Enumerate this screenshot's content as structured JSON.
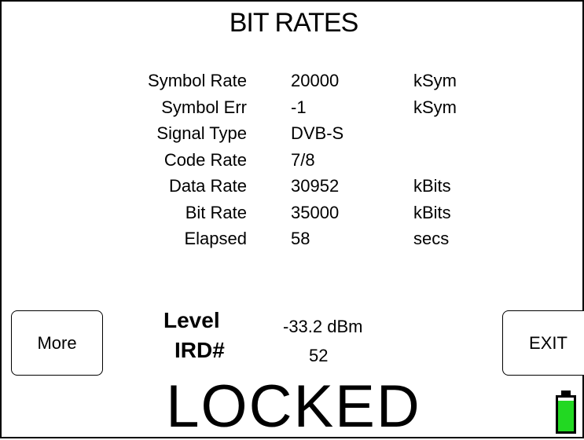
{
  "screen": {
    "title": "BIT RATES"
  },
  "rows": [
    {
      "label": "Symbol Rate",
      "value": "20000",
      "unit": "kSym"
    },
    {
      "label": "Symbol Err",
      "value": "-1",
      "unit": "kSym"
    },
    {
      "label": "Signal Type",
      "value": "DVB-S",
      "unit": ""
    },
    {
      "label": "Code Rate",
      "value": "7/8",
      "unit": ""
    },
    {
      "label": "Data Rate",
      "value": "30952",
      "unit": "kBits"
    },
    {
      "label": "Bit Rate",
      "value": "35000",
      "unit": "kBits"
    },
    {
      "label": "Elapsed",
      "value": "58",
      "unit": "secs"
    }
  ],
  "buttons": {
    "more": "More",
    "exit": "EXIT"
  },
  "level": {
    "label": "Level",
    "value": "-33.2 dBm"
  },
  "ird": {
    "label": "IRD#",
    "value": "52"
  },
  "status": "LOCKED",
  "battery": {
    "level": 0.9,
    "color": "#22d822"
  }
}
